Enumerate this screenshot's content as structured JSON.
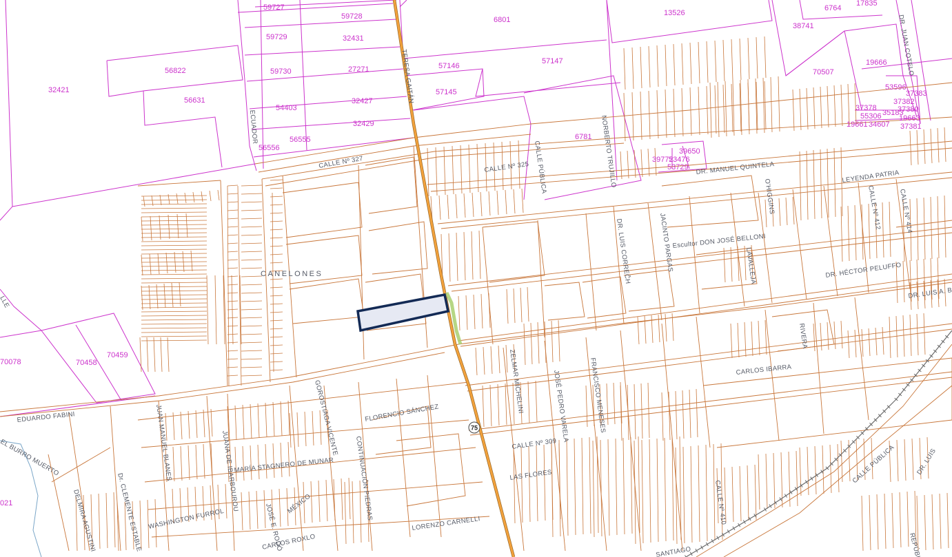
{
  "colors": {
    "background": "#ffffff",
    "parcel_line": "#c8763a",
    "cadastral_line": "#cc33cc",
    "cadastral_label": "#cc33cc",
    "road": "#f3a23c",
    "road_edge": "#9a6a2a",
    "railway": "#6b6b6b",
    "stream": "#7aa6c8",
    "street_label": "#555a66",
    "selection_fill": "#e6e9f3",
    "selection_stroke": "#132a55",
    "green_strip": "#a9cf6e"
  },
  "map": {
    "town_label": "CANELONES",
    "route_shield": "75",
    "selected_parcel": "highlighted-parcel",
    "lot_numbers": [
      "59727",
      "59728",
      "59729",
      "32431",
      "59730",
      "27271",
      "54403",
      "32427",
      "32429",
      "56556",
      "56555",
      "56822",
      "56631",
      "32421",
      "6801",
      "13526",
      "57146",
      "57147",
      "57145",
      "6781",
      "38741",
      "6764",
      "17835",
      "70507",
      "19666",
      "53596",
      "37383",
      "37378",
      "37382",
      "55306",
      "35183",
      "37380",
      "19661",
      "34607",
      "19663",
      "37381",
      "39650",
      "39772",
      "53476",
      "53729",
      "70078",
      "70458",
      "70459",
      "021"
    ],
    "street_names": [
      "CALLE Nº 327",
      "CALLE Nº 325",
      "TERESA GAITÁN",
      "ECUADOR",
      "CALLE PÚBLICA",
      "NORBERTO TRUJILLO",
      "DR. JUAN COTELO",
      "DR. MANUEL QUINTELA",
      "O'HIGGINS",
      "LEYENDA PATRIA",
      "CALLE Nº 412",
      "CALLE Nº 414",
      "Escultor DON JOSÉ BELLONI",
      "DR. LUIS CORREČH",
      "JACINTO PARGAS",
      "LAVALLEJA",
      "DR. HÉCTOR PELUFFO",
      "DR. LUIS A. BR",
      "RIVERA",
      "CARLOS IBARRA",
      "ZELMAR MICHELINI",
      "JOSÉ PEDRO VARELA",
      "FRANCISCO MENESES",
      "GOROSTIAGA VICENTE",
      "FLORENCIO SÁNCHEZ",
      "EDUARDO FABINI",
      "JUAN MANUEL BLANES",
      "JUANA DE IBARBOUROU",
      "MARÍA STAGNERO DE MUNAR",
      "CONTINUACIÓN PIEDRAS",
      "CALLE Nº 309",
      "LAS FLORES",
      "LORENZO CARNELLI",
      "Dr. CLEMENTE ESTABLE",
      "DELMIRA AGUSTINI",
      "WASHINGTON FURROL",
      "JOSÉ E. RODÓ",
      "MÉXICO",
      "CARLOS ROXLO",
      "CALLE Nº 410",
      "SANTIAGO",
      "REPÚBLICA",
      "CALLE PÚBLICA",
      "EL BURRO MUERTO",
      "DR. LUIS"
    ],
    "partial_street_prefix": "LLE"
  }
}
